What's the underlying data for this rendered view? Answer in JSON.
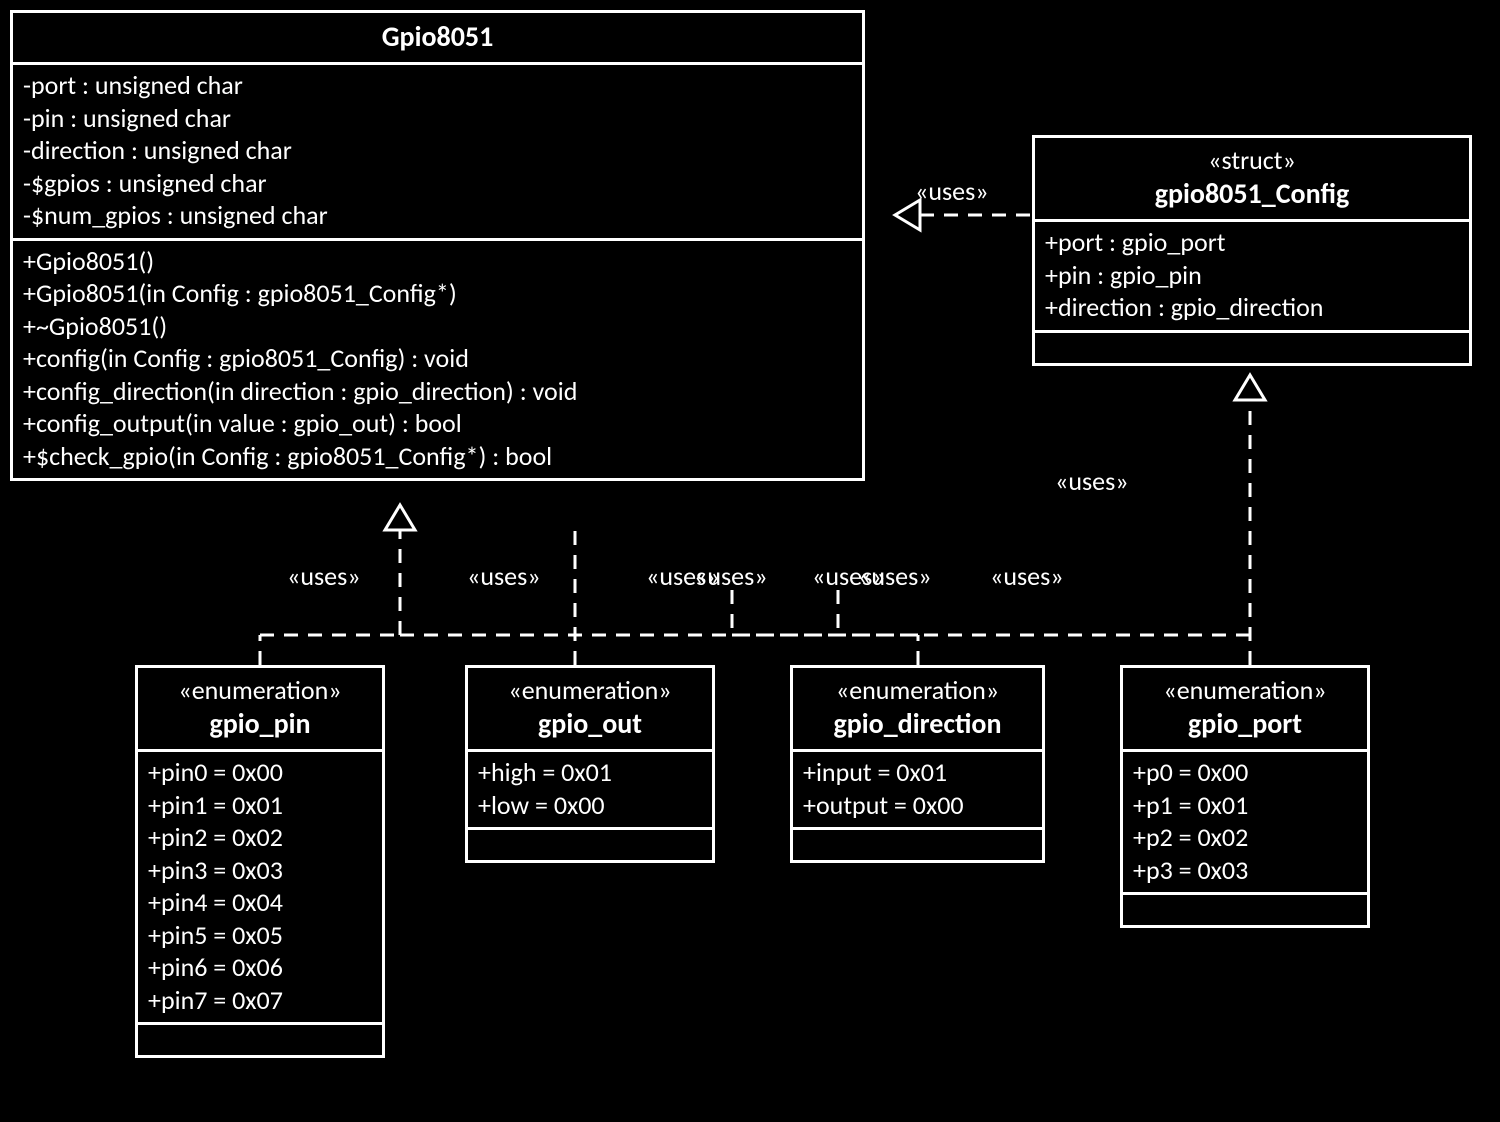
{
  "labels": {
    "uses": "«uses»",
    "enum_stereo": "«enumeration»",
    "struct_stereo": "«struct»"
  },
  "classes": {
    "Gpio8051": {
      "name": "Gpio8051",
      "attributes": [
        "-port : unsigned char",
        "-pin : unsigned char",
        "-direction : unsigned char",
        "-$gpios : unsigned char",
        "-$num_gpios : unsigned char"
      ],
      "operations": [
        "+Gpio8051()",
        "+Gpio8051(in Config : gpio8051_Config*)",
        "+~Gpio8051()",
        "+config(in Config : gpio8051_Config) : void",
        "+config_direction(in direction : gpio_direction) : void",
        "+config_output(in value : gpio_out) : bool",
        "+$check_gpio(in Config : gpio8051_Config*) : bool"
      ]
    },
    "gpio8051_Config": {
      "stereotype": "«struct»",
      "name": "gpio8051_Config",
      "attributes": [
        "+port : gpio_port",
        "+pin : gpio_pin",
        "+direction : gpio_direction"
      ]
    },
    "gpio_pin": {
      "stereotype": "«enumeration»",
      "name": "gpio_pin",
      "values": [
        "+pin0 = 0x00",
        "+pin1 = 0x01",
        "+pin2 = 0x02",
        "+pin3 = 0x03",
        "+pin4 = 0x04",
        "+pin5 = 0x05",
        "+pin6 = 0x06",
        "+pin7 = 0x07"
      ]
    },
    "gpio_out": {
      "stereotype": "«enumeration»",
      "name": "gpio_out",
      "values": [
        "+high = 0x01",
        "+low = 0x00"
      ]
    },
    "gpio_direction": {
      "stereotype": "«enumeration»",
      "name": "gpio_direction",
      "values": [
        "+input = 0x01",
        "+output = 0x00"
      ]
    },
    "gpio_port": {
      "stereotype": "«enumeration»",
      "name": "gpio_port",
      "values": [
        "+p0 = 0x00",
        "+p1 = 0x01",
        "+p2 = 0x02",
        "+p3 = 0x03"
      ]
    }
  }
}
